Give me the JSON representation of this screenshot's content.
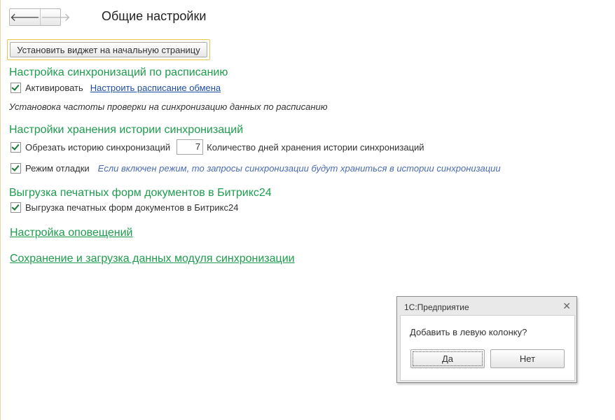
{
  "nav": {
    "back_glyph": "🡐",
    "forward_glyph": "🡒",
    "back_icon": "arrow-left-icon",
    "forward_icon": "arrow-right-icon"
  },
  "page": {
    "title": "Общие настройки"
  },
  "widget_button": {
    "label": "Установить виджет на начальную страницу"
  },
  "sync_schedule": {
    "heading": "Настройка синхронизаций по расписанию",
    "activate_label": "Активировать",
    "activate_checked": true,
    "schedule_link": "Настроить расписание обмена",
    "note": "Установока частоты проверки на синхронизацию данных по расписанию"
  },
  "history": {
    "heading": "Настройки хранения истории синхронизаций",
    "trim_label": "Обрезать историю синхронизаций",
    "trim_checked": true,
    "days_value": "7",
    "days_label": "Количество дней хранения истории синхронизаций",
    "debug_label": "Режим отладки",
    "debug_checked": true,
    "debug_hint": "Если включен режим, то запросы синхронизации будут храниться в истории синхронизации"
  },
  "print_forms": {
    "heading": "Выгрузка печатных форм документов в Битрикс24",
    "export_label": "Выгрузка печатных форм документов в Битрикс24",
    "export_checked": true
  },
  "links": {
    "notifications": "Настройка оповещений",
    "save_load": "Сохранение и загрузка данных модуля синхронизации"
  },
  "dialog": {
    "title": "1С:Предприятие",
    "close_glyph": "✕",
    "message": "Добавить в левую колонку?",
    "yes": "Да",
    "no": "Нет"
  },
  "colors": {
    "section_green": "#1e9c4e",
    "link_blue": "#1f4fa5",
    "hint_blue": "#4a6bb5",
    "focus_yellow": "#e8c74a"
  }
}
